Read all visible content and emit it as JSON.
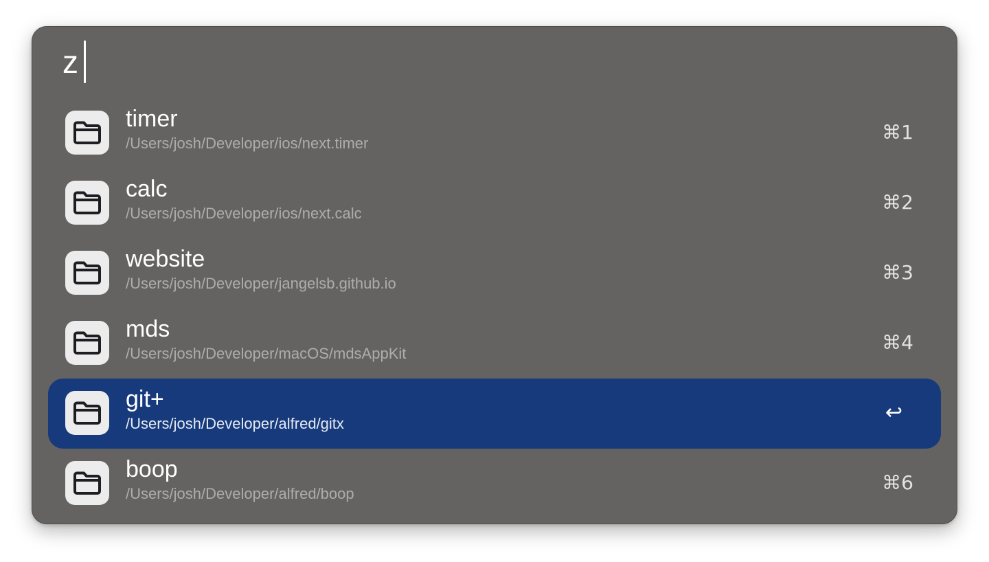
{
  "search": {
    "query": "z"
  },
  "results": [
    {
      "title": "timer",
      "path": "/Users/josh/Developer/ios/next.timer",
      "shortcut": "⌘1",
      "icon": "folder-icon",
      "selected": false
    },
    {
      "title": "calc",
      "path": "/Users/josh/Developer/ios/next.calc",
      "shortcut": "⌘2",
      "icon": "folder-icon",
      "selected": false
    },
    {
      "title": "website",
      "path": "/Users/josh/Developer/jangelsb.github.io",
      "shortcut": "⌘3",
      "icon": "folder-icon",
      "selected": false
    },
    {
      "title": "mds",
      "path": "/Users/josh/Developer/macOS/mdsAppKit",
      "shortcut": "⌘4",
      "icon": "folder-icon",
      "selected": false
    },
    {
      "title": "git+",
      "path": "/Users/josh/Developer/alfred/gitx",
      "shortcut": "↩",
      "icon": "folder-icon",
      "selected": true
    },
    {
      "title": "boop",
      "path": "/Users/josh/Developer/alfred/boop",
      "shortcut": "⌘6",
      "icon": "folder-icon",
      "selected": false
    }
  ],
  "colors": {
    "panel": "#646362",
    "selection": "#163a7b",
    "icon_tile": "#ececec",
    "icon_stroke": "#1e1e22"
  }
}
